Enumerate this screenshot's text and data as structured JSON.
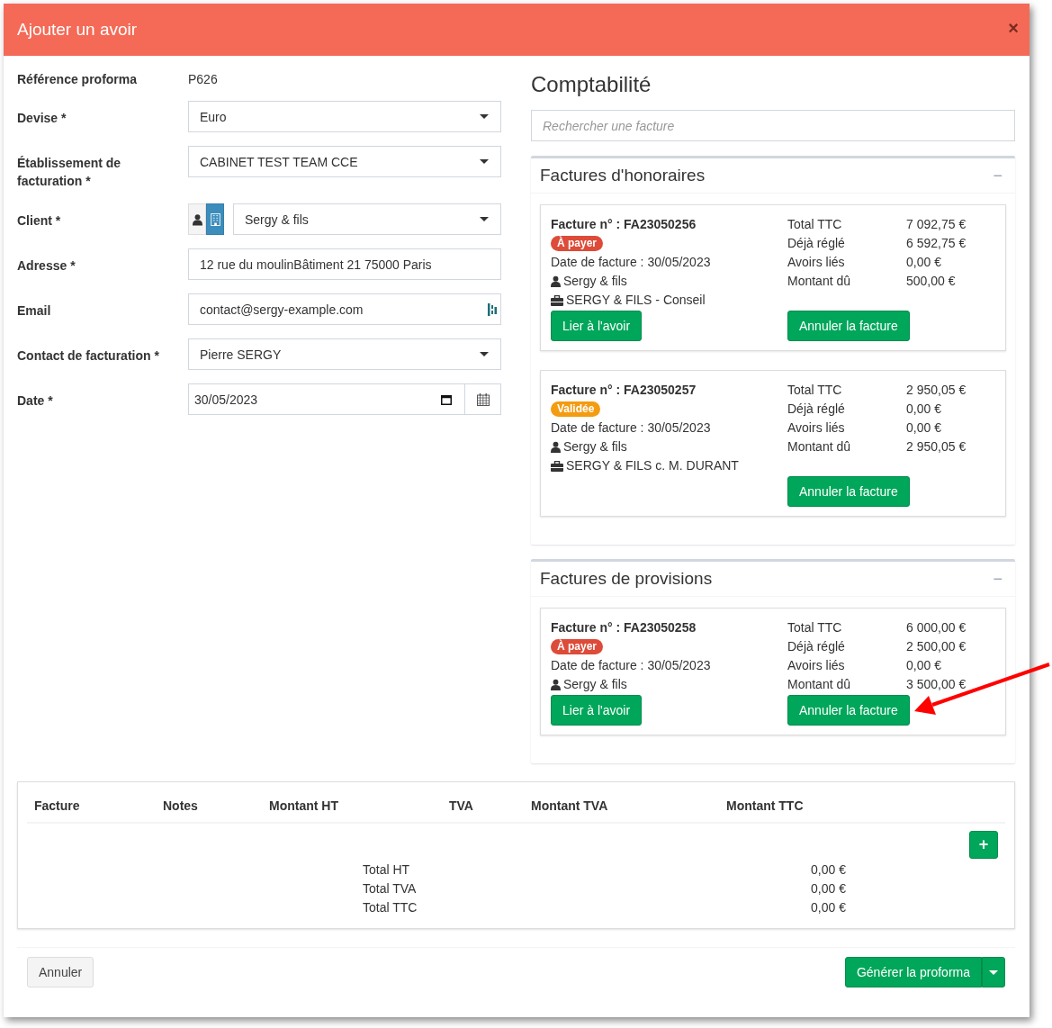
{
  "modal": {
    "title": "Ajouter un avoir",
    "close": "×"
  },
  "form": [
    {
      "kind": "static",
      "label": "Référence proforma",
      "value": "P626"
    },
    {
      "kind": "select",
      "label": "Devise *",
      "value": "Euro"
    },
    {
      "kind": "select",
      "label": "Établissement de facturation *",
      "value": "CABINET TEST TEAM CCE"
    },
    {
      "kind": "client",
      "label": "Client *",
      "value": "Sergy & fils",
      "toggle": [
        {
          "kind": "person",
          "selected": false
        },
        {
          "kind": "company",
          "selected": true
        }
      ]
    },
    {
      "kind": "text",
      "label": "Adresse *",
      "value": "12 rue du moulinBâtiment 21 75000 Paris"
    },
    {
      "kind": "email",
      "label": "Email",
      "value": "contact@sergy-example.com"
    },
    {
      "kind": "select",
      "label": "Contact de facturation *",
      "value": "Pierre SERGY"
    },
    {
      "kind": "date",
      "label": "Date *",
      "value": "30/05/2023"
    }
  ],
  "accounting": {
    "title": "Comptabilité",
    "search": {
      "placeholder": "Rechercher une facture"
    },
    "panels": [
      {
        "title": "Factures d'honoraires",
        "collapse": "−",
        "invoices": [
          {
            "number": "Facture n° : FA23050256",
            "status": {
              "label": "À payer",
              "color": "#dd4b39"
            },
            "date": "Date de facture : 30/05/2023",
            "client": "Sergy & fils",
            "case": "SERGY & FILS - Conseil",
            "totals": [
              {
                "label": "Total TTC",
                "value": "7 092,75 €"
              },
              {
                "label": "Déjà réglé",
                "value": "6 592,75 €"
              },
              {
                "label": "Avoirs liés",
                "value": "0,00 €"
              },
              {
                "label": "Montant dû",
                "value": "500,00 €"
              }
            ],
            "link_button": "Lier à l'avoir",
            "cancel_button": "Annuler la facture"
          },
          {
            "number": "Facture n° : FA23050257",
            "status": {
              "label": "Validée",
              "color": "#f39c12"
            },
            "date": "Date de facture : 30/05/2023",
            "client": "Sergy & fils",
            "case": "SERGY & FILS c. M. DURANT",
            "totals": [
              {
                "label": "Total TTC",
                "value": "2 950,05 €"
              },
              {
                "label": "Déjà réglé",
                "value": "0,00 €"
              },
              {
                "label": "Avoirs liés",
                "value": "0,00 €"
              },
              {
                "label": "Montant dû",
                "value": "2 950,05 €"
              }
            ],
            "cancel_button": "Annuler la facture"
          }
        ]
      },
      {
        "title": "Factures de provisions",
        "collapse": "−",
        "invoices": [
          {
            "number": "Facture n° : FA23050258",
            "status": {
              "label": "À payer",
              "color": "#dd4b39"
            },
            "date": "Date de facture : 30/05/2023",
            "client": "Sergy & fils",
            "totals": [
              {
                "label": "Total TTC",
                "value": "6 000,00 €"
              },
              {
                "label": "Déjà réglé",
                "value": "2 500,00 €"
              },
              {
                "label": "Avoirs liés",
                "value": "0,00 €"
              },
              {
                "label": "Montant dû",
                "value": "3 500,00 €"
              }
            ],
            "link_button": "Lier à l'avoir",
            "cancel_button": "Annuler la facture"
          }
        ]
      }
    ]
  },
  "lines_table": {
    "columns": [
      "Facture",
      "Notes",
      "Montant HT",
      "TVA",
      "Montant TVA",
      "Montant TTC"
    ],
    "add_button": "+",
    "totals": [
      {
        "label": "Total HT",
        "value": "0,00 €"
      },
      {
        "label": "Total TVA",
        "value": "0,00 €"
      },
      {
        "label": "Total TTC",
        "value": "0,00 €"
      }
    ]
  },
  "footer": {
    "cancel_button": "Annuler",
    "submit_button": "Générer la proforma"
  },
  "annotations": [
    {
      "kind": "arrow"
    }
  ]
}
